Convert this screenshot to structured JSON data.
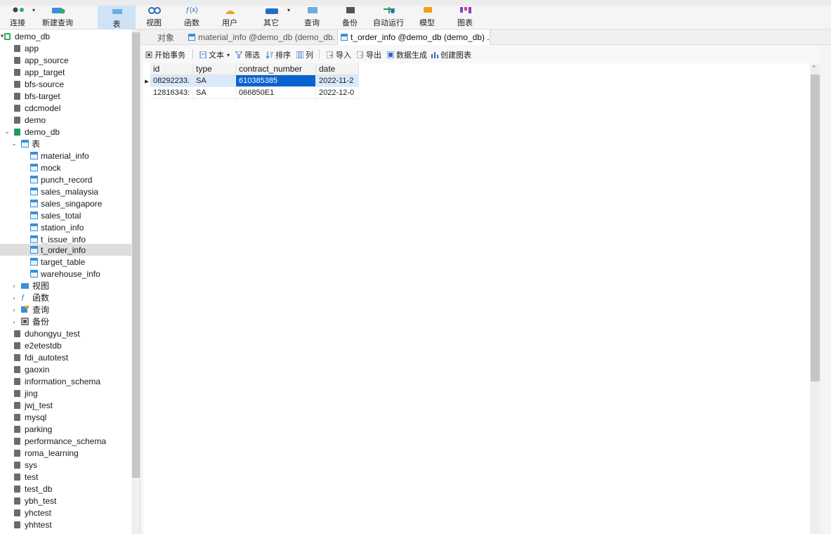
{
  "toolbar": {
    "buttons": [
      {
        "label": "连接"
      },
      {
        "label": "新建查询"
      },
      {
        "label": "表"
      },
      {
        "label": "视图"
      },
      {
        "label": "函数"
      },
      {
        "label": "用户"
      },
      {
        "label": "其它"
      },
      {
        "label": "查询"
      },
      {
        "label": "备份"
      },
      {
        "label": "自动运行"
      },
      {
        "label": "模型"
      },
      {
        "label": "图表"
      }
    ]
  },
  "sidebar": {
    "items": [
      {
        "label": "demo_db"
      },
      {
        "label": "app"
      },
      {
        "label": "app_source"
      },
      {
        "label": "app_target"
      },
      {
        "label": "bfs-source"
      },
      {
        "label": "bfs-target"
      },
      {
        "label": "cdcmodel"
      },
      {
        "label": "demo"
      },
      {
        "label": "demo_db"
      },
      {
        "label": "表"
      },
      {
        "label": "material_info"
      },
      {
        "label": "mock"
      },
      {
        "label": "punch_record"
      },
      {
        "label": "sales_malaysia"
      },
      {
        "label": "sales_singapore"
      },
      {
        "label": "sales_total"
      },
      {
        "label": "station_info"
      },
      {
        "label": "t_issue_info"
      },
      {
        "label": "t_order_info"
      },
      {
        "label": "target_table"
      },
      {
        "label": "warehouse_info"
      },
      {
        "label": "视图"
      },
      {
        "label": "函数"
      },
      {
        "label": "查询"
      },
      {
        "label": "备份"
      },
      {
        "label": "duhongyu_test"
      },
      {
        "label": "e2etestdb"
      },
      {
        "label": "fdi_autotest"
      },
      {
        "label": "gaoxin"
      },
      {
        "label": "information_schema"
      },
      {
        "label": "jing"
      },
      {
        "label": "jwj_test"
      },
      {
        "label": "mysql"
      },
      {
        "label": "parking"
      },
      {
        "label": "performance_schema"
      },
      {
        "label": "roma_learning"
      },
      {
        "label": "sys"
      },
      {
        "label": "test"
      },
      {
        "label": "test_db"
      },
      {
        "label": "ybh_test"
      },
      {
        "label": "yhctest"
      },
      {
        "label": "yhhtest"
      }
    ]
  },
  "tabs": [
    {
      "label": "对象"
    },
    {
      "label": "material_info @demo_db (demo_db..."
    },
    {
      "label": "t_order_info @demo_db (demo_db) ..."
    }
  ],
  "actions": [
    {
      "label": "开始事务"
    },
    {
      "label": "文本"
    },
    {
      "label": "筛选"
    },
    {
      "label": "排序"
    },
    {
      "label": "列"
    },
    {
      "label": "导入"
    },
    {
      "label": "导出"
    },
    {
      "label": "数据生成"
    },
    {
      "label": "创建图表"
    }
  ],
  "grid": {
    "columns": [
      "id",
      "type",
      "contract_number",
      "date"
    ],
    "rows": [
      [
        "08292233.",
        "SA",
        "610385385",
        "2022-11-2"
      ],
      [
        "12816343:",
        "SA",
        "066850E1",
        "2022-12-0"
      ]
    ]
  },
  "colors": {
    "selection": "#0a63d0",
    "row_highlight": "#d9e9f9",
    "tool_active": "#cfe3f7",
    "db_active": "#1e9c5a"
  }
}
